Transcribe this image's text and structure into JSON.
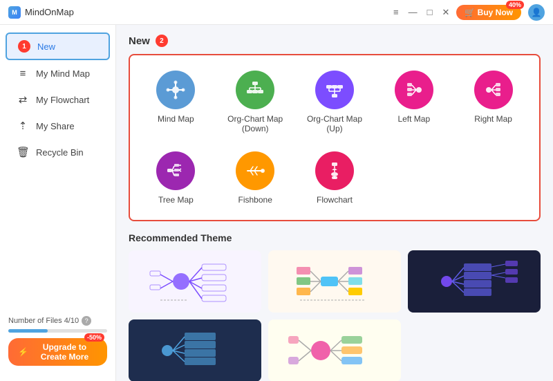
{
  "app": {
    "title": "MindOnMap",
    "buy_label": "Buy Now",
    "buy_badge": "40%",
    "window_controls": [
      "≡",
      "—",
      "□",
      "✕"
    ]
  },
  "sidebar": {
    "items": [
      {
        "id": "new",
        "label": "New",
        "icon": "⊕",
        "active": true
      },
      {
        "id": "my-mind-map",
        "label": "My Mind Map",
        "icon": "≡"
      },
      {
        "id": "my-flowchart",
        "label": "My Flowchart",
        "icon": "⇄"
      },
      {
        "id": "my-share",
        "label": "My Share",
        "icon": "⇡"
      },
      {
        "id": "recycle-bin",
        "label": "Recycle Bin",
        "icon": "🗑"
      }
    ],
    "files_label": "Number of Files 4/10",
    "upgrade_label": "Upgrade to Create More",
    "upgrade_badge": "-50%"
  },
  "new_section": {
    "title": "New",
    "badge": "2",
    "templates": [
      {
        "id": "mind-map",
        "label": "Mind Map",
        "color": "#5b9bd5",
        "icon": "✦"
      },
      {
        "id": "org-chart-down",
        "label": "Org-Chart Map (Down)",
        "color": "#4caf50",
        "icon": "⊞"
      },
      {
        "id": "org-chart-up",
        "label": "Org-Chart Map (Up)",
        "color": "#7c4dff",
        "icon": "⊟"
      },
      {
        "id": "left-map",
        "label": "Left Map",
        "color": "#e91e8c",
        "icon": "⇤"
      },
      {
        "id": "right-map",
        "label": "Right Map",
        "color": "#e91e8c",
        "icon": "⇥"
      },
      {
        "id": "tree-map",
        "label": "Tree Map",
        "color": "#9c27b0",
        "icon": "⌥"
      },
      {
        "id": "fishbone",
        "label": "Fishbone",
        "color": "#ff9800",
        "icon": "⌀"
      },
      {
        "id": "flowchart",
        "label": "Flowchart",
        "color": "#e91e63",
        "icon": "⊛"
      }
    ]
  },
  "recommended": {
    "title": "Recommended Theme",
    "themes": [
      {
        "id": "theme-1",
        "bg": "#f8f4ff",
        "type": "light"
      },
      {
        "id": "theme-2",
        "bg": "#fff9f0",
        "type": "colorful"
      },
      {
        "id": "theme-3",
        "bg": "#1a1f3a",
        "type": "dark"
      },
      {
        "id": "theme-4",
        "bg": "#1e2d4e",
        "type": "blue-dark"
      },
      {
        "id": "theme-5",
        "bg": "#fffef0",
        "type": "pastel"
      }
    ]
  },
  "icons": {
    "cart": "🛒",
    "user": "👤",
    "question": "?",
    "lightning": "⚡"
  }
}
